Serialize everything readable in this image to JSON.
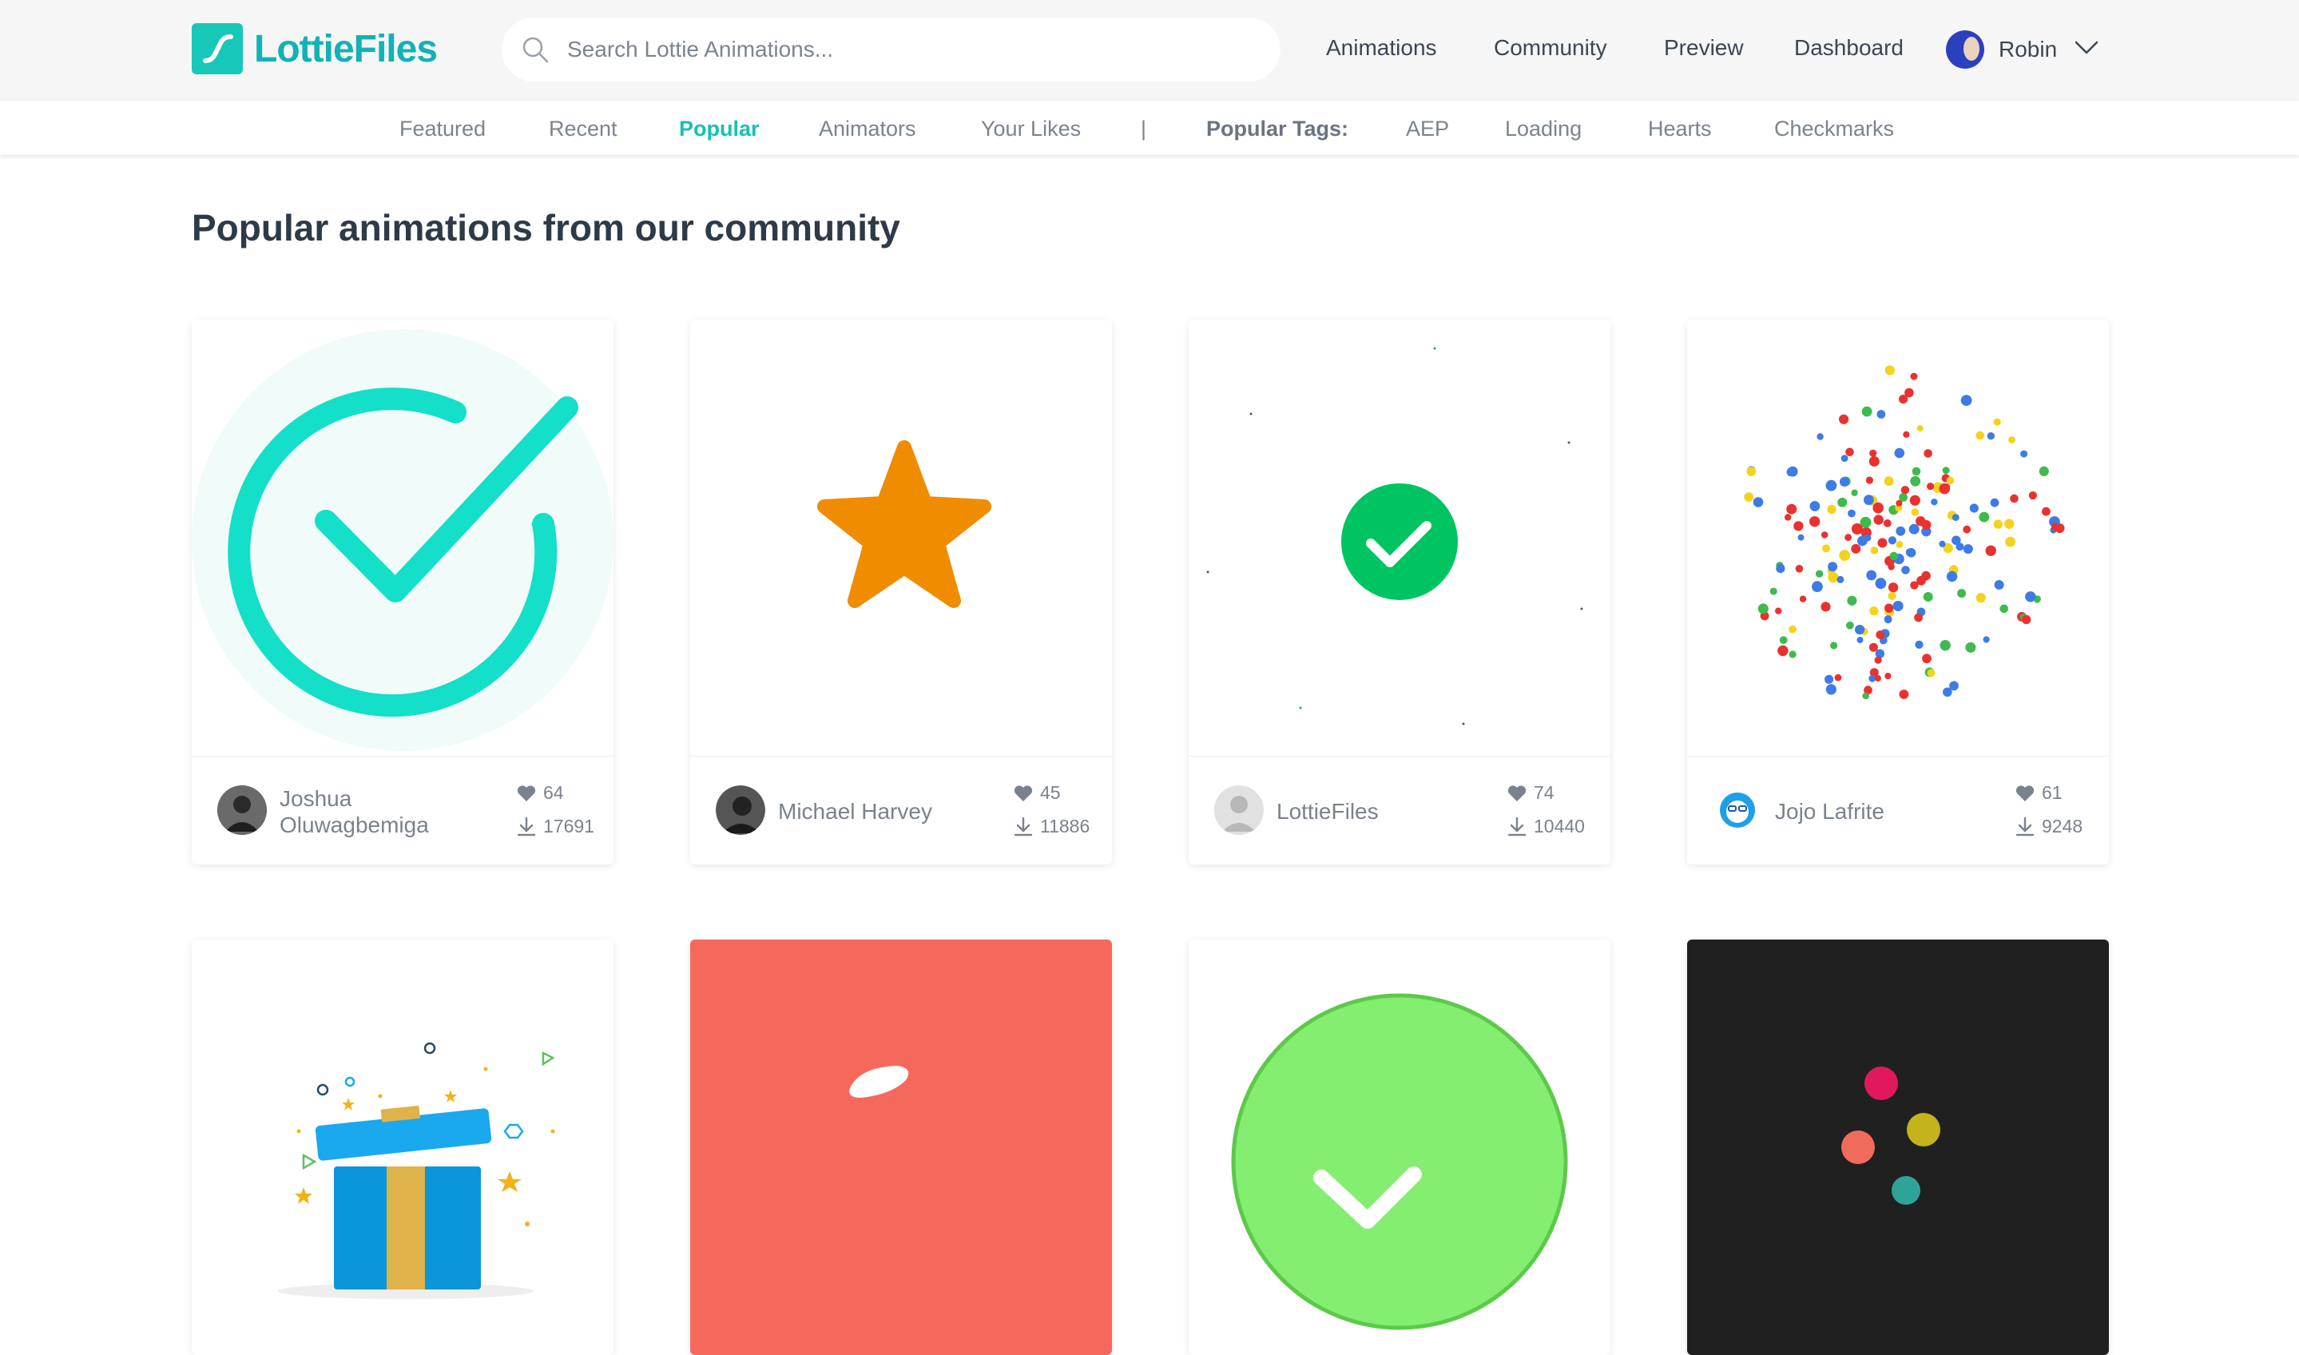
{
  "header": {
    "logo_text": "LottieFiles",
    "search_placeholder": "Search Lottie Animations...",
    "nav": [
      "Animations",
      "Community",
      "Preview",
      "Dashboard"
    ],
    "user_name": "Robin"
  },
  "subnav": {
    "items": [
      "Featured",
      "Recent",
      "Popular",
      "Animators",
      "Your Likes"
    ],
    "active": "Popular",
    "separator": "|",
    "tags_label": "Popular Tags:",
    "tags": [
      "AEP",
      "Loading",
      "Hearts",
      "Checkmarks"
    ]
  },
  "page_title": "Popular animations from our community",
  "cards": [
    {
      "author_line1": "Joshua",
      "author_line2": "Oluwagbemiga",
      "likes": "64",
      "downloads": "17691",
      "icon": "teal-checkmark-circle"
    },
    {
      "author_line1": "Michael Harvey",
      "author_line2": "",
      "likes": "45",
      "downloads": "11886",
      "icon": "orange-star"
    },
    {
      "author_line1": "LottieFiles",
      "author_line2": "",
      "likes": "74",
      "downloads": "10440",
      "icon": "green-check-badge"
    },
    {
      "author_line1": "Jojo Lafrite",
      "author_line2": "",
      "likes": "61",
      "downloads": "9248",
      "icon": "confetti-burst"
    }
  ],
  "second_row_icons": [
    "gift-box-confetti",
    "coral-brush-stroke",
    "green-check-circle",
    "colored-dots"
  ],
  "colors": {
    "accent": "#17c1b4",
    "text_dark": "#2f3a48",
    "text_muted": "#7a828c",
    "header_bg": "#f6f6f6",
    "star": "#ef8c00",
    "check_green": "#00c462",
    "coral": "#f5695c",
    "light_green": "#84ee70",
    "dark_card": "#202020"
  }
}
